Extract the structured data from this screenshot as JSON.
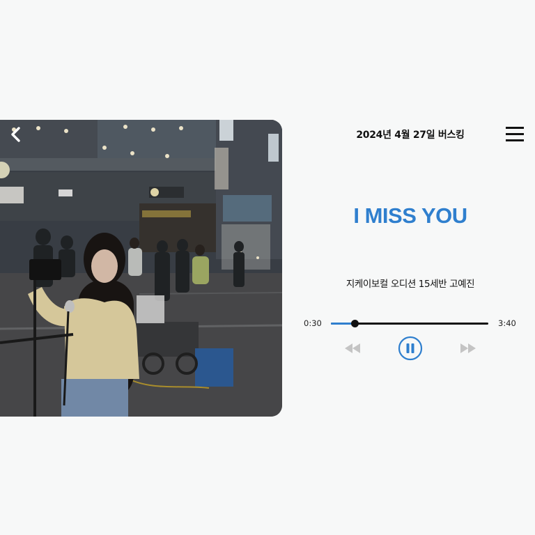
{
  "header": {
    "title": "2024년 4월 27일 버스킹",
    "back_icon": "chevron-left-icon",
    "menu_icon": "hamburger-menu-icon"
  },
  "song": {
    "title": "I MISS YOU",
    "artist": "지케이보컬 오디션 15세반 고예진"
  },
  "player": {
    "elapsed": "0:30",
    "total": "3:40",
    "progress_fraction": 0.152,
    "state": "playing",
    "controls": [
      "rewind-icon",
      "pause-icon",
      "fast-forward-icon"
    ]
  },
  "colors": {
    "accent": "#2f7fce",
    "text": "#111111",
    "background": "#f7f8f8",
    "inactive_control": "#c4c4c4"
  }
}
